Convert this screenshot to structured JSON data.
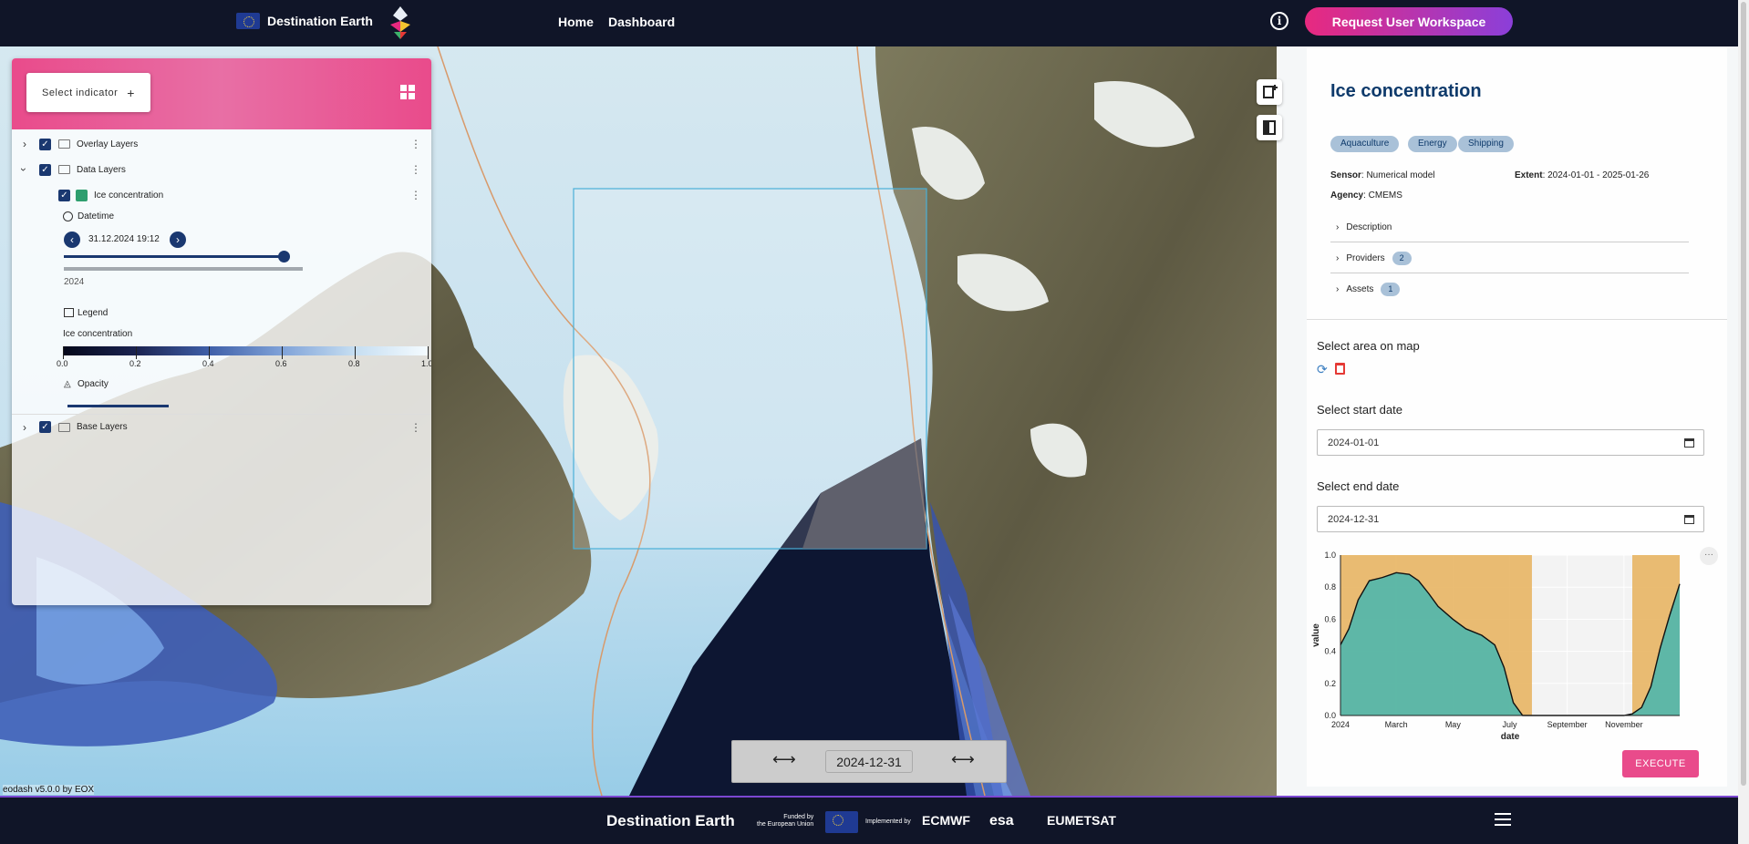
{
  "header": {
    "brand": "Destination Earth",
    "nav": [
      "Home",
      "Dashboard"
    ],
    "request_button": "Request User Workspace"
  },
  "layers_panel": {
    "select_indicator": "Select indicator",
    "overlay_layers": "Overlay Layers",
    "data_layers": "Data Layers",
    "ice_layer": "Ice concentration",
    "datetime_label": "Datetime",
    "datetime_value": "31.12.2024 19:12",
    "year_label": "2024",
    "legend_label": "Legend",
    "legend_title": "Ice concentration",
    "legend_ticks": [
      "0.0",
      "0.2",
      "0.4",
      "0.6",
      "0.8",
      "1.0"
    ],
    "opacity_label": "Opacity",
    "base_layers": "Base Layers",
    "time_slider_fraction": 0.98,
    "opacity_fraction": 0.3
  },
  "info_panel": {
    "title": "Ice concentration",
    "tags": [
      "Aquaculture",
      "Energy",
      "Shipping"
    ],
    "sensor_label": "Sensor",
    "sensor_value": ": Numerical model",
    "extent_label": "Extent",
    "extent_value": ": 2024-01-01 - 2025-01-26",
    "agency_label": "Agency",
    "agency_value": ": CMEMS",
    "description": "Description",
    "providers": "Providers",
    "providers_count": "2",
    "assets": "Assets",
    "assets_count": "1"
  },
  "process_panel": {
    "select_area": "Select area on map",
    "start_label": "Select start date",
    "start_value": "2024-01-01",
    "end_label": "Select end date",
    "end_value": "2024-12-31",
    "execute": "EXECUTE"
  },
  "time_control": {
    "date": "2024-12-31"
  },
  "version": "eodash v5.0.0 by EOX",
  "footer": {
    "title": "Destination Earth",
    "funded_line1": "Funded by",
    "funded_line2": "the European Union",
    "implemented": "Implemented by",
    "orgs": [
      "ECMWF",
      "esa",
      "EUMETSAT"
    ]
  },
  "chart_data": {
    "type": "area",
    "xlabel": "date",
    "ylabel": "value",
    "ylim": [
      0,
      1.0
    ],
    "y_ticks": [
      "0.0",
      "0.2",
      "0.4",
      "0.6",
      "0.8",
      "1.0"
    ],
    "x_ticks": [
      "2024",
      "March",
      "May",
      "July",
      "September",
      "November"
    ],
    "x_domain": [
      "2024-01-01",
      "2024-12-31"
    ],
    "series": [
      {
        "color": "#4fb7ad",
        "x": [
          "2024-01-01",
          "2024-01-10",
          "2024-01-20",
          "2024-02-01",
          "2024-02-15",
          "2024-03-01",
          "2024-03-15",
          "2024-03-25",
          "2024-04-05",
          "2024-04-15",
          "2024-05-01",
          "2024-05-15",
          "2024-06-01",
          "2024-06-15",
          "2024-06-25",
          "2024-07-05",
          "2024-07-15",
          "2024-08-01",
          "2024-08-15",
          "2024-09-01",
          "2024-09-15",
          "2024-10-01",
          "2024-10-15",
          "2024-11-01",
          "2024-11-10",
          "2024-11-20",
          "2024-11-30",
          "2024-12-10",
          "2024-12-20",
          "2024-12-31"
        ],
        "values": [
          0.44,
          0.54,
          0.72,
          0.84,
          0.86,
          0.89,
          0.88,
          0.84,
          0.76,
          0.68,
          0.6,
          0.54,
          0.5,
          0.44,
          0.3,
          0.08,
          0.0,
          0.0,
          0.0,
          0.0,
          0.0,
          0.0,
          0.0,
          0.0,
          0.01,
          0.05,
          0.18,
          0.42,
          0.62,
          0.82
        ]
      }
    ],
    "masked_ranges": [
      [
        "2024-01-01",
        "2024-07-25"
      ],
      [
        "2024-11-10",
        "2024-12-31"
      ]
    ],
    "mask_color": "#e6b05a"
  }
}
